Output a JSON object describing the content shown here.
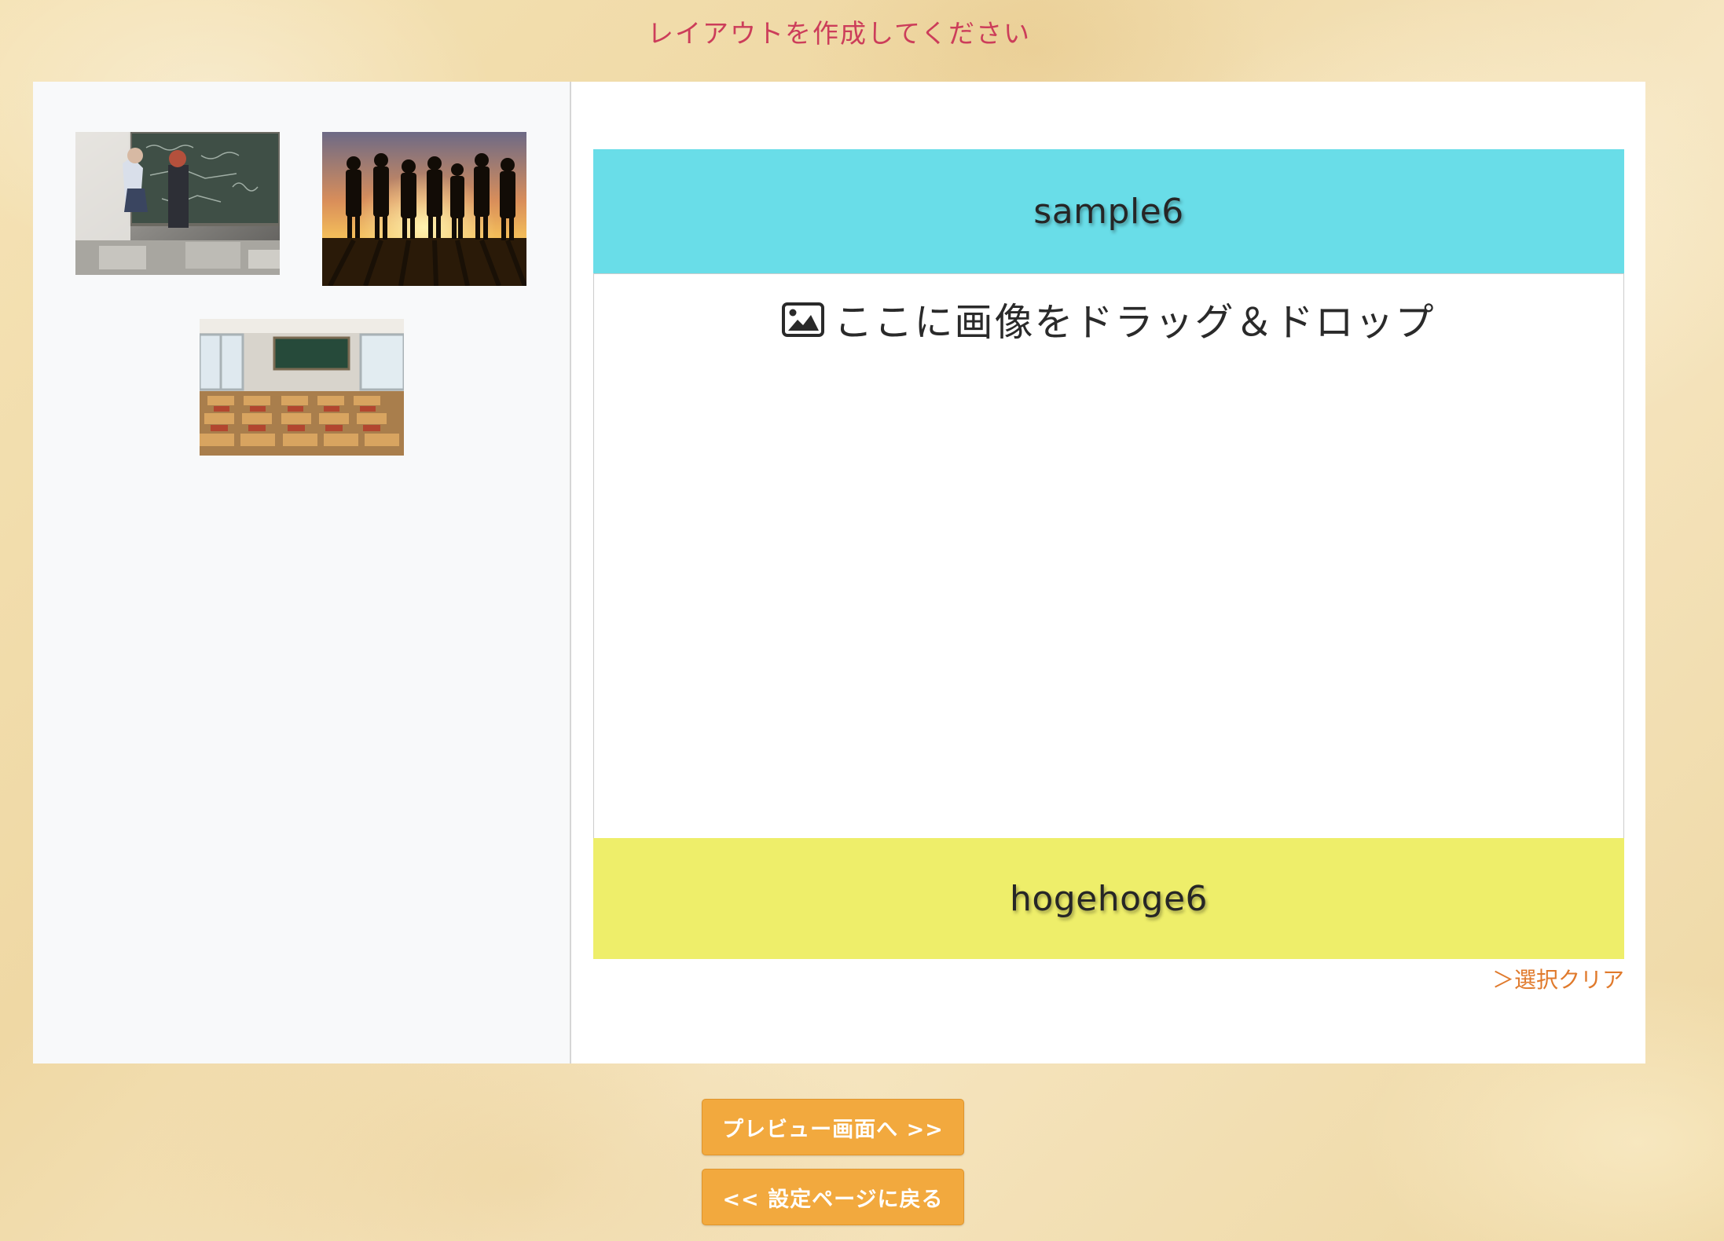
{
  "page": {
    "title": "レイアウトを作成してください"
  },
  "library": {
    "images": [
      {
        "name": "anime-classroom-chalkboard"
      },
      {
        "name": "sunset-silhouettes"
      },
      {
        "name": "empty-classroom"
      }
    ]
  },
  "layout": {
    "header_text": "sample6",
    "header_color": "#69dde8",
    "dropzone_text": "ここに画像をドラッグ＆ドロップ",
    "dropzone_icon": "image-icon",
    "footer_text": "hogehoge6",
    "footer_color": "#eeee6a",
    "clear_label": "＞選択クリア"
  },
  "buttons": {
    "preview_label": "プレビュー画面へ >>",
    "back_label": "<< 設定ページに戻る",
    "color": "#f2a93e"
  }
}
